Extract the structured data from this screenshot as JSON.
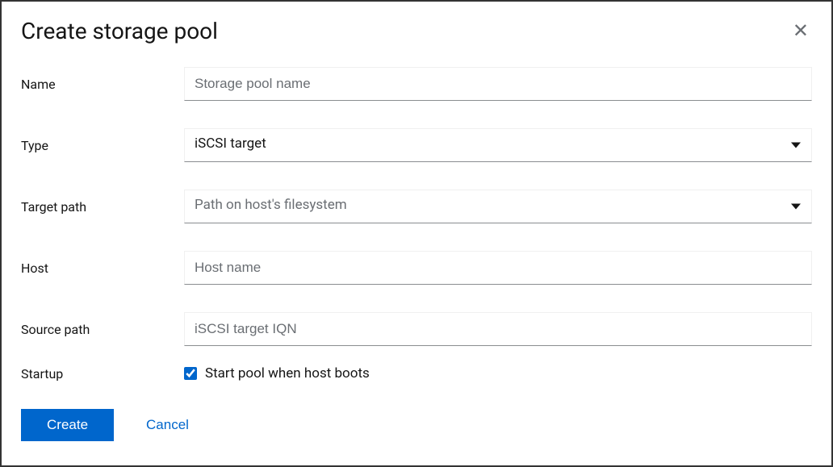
{
  "dialog": {
    "title": "Create storage pool"
  },
  "form": {
    "name": {
      "label": "Name",
      "placeholder": "Storage pool name",
      "value": ""
    },
    "type": {
      "label": "Type",
      "value": "iSCSI target"
    },
    "target_path": {
      "label": "Target path",
      "placeholder": "Path on host's filesystem",
      "value": ""
    },
    "host": {
      "label": "Host",
      "placeholder": "Host name",
      "value": ""
    },
    "source_path": {
      "label": "Source path",
      "placeholder": "iSCSI target IQN",
      "value": ""
    },
    "startup": {
      "label": "Startup",
      "checkbox_label": "Start pool when host boots",
      "checked": true
    }
  },
  "footer": {
    "create_label": "Create",
    "cancel_label": "Cancel"
  }
}
